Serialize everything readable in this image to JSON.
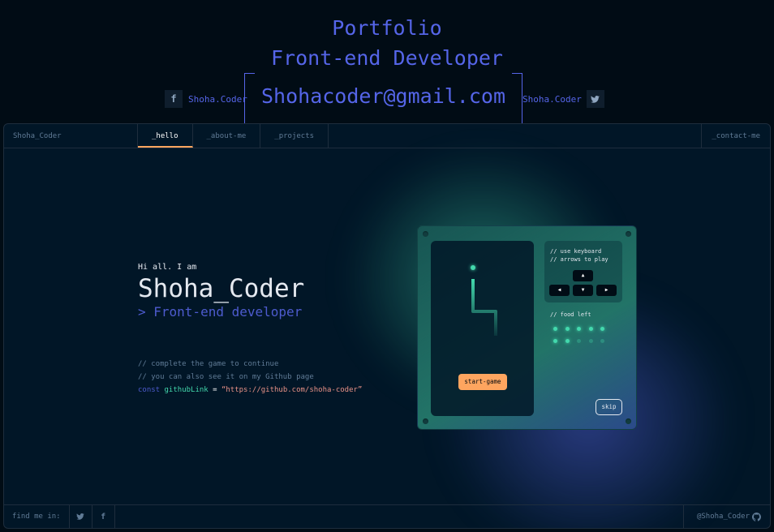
{
  "header": {
    "line1": "Portfolio",
    "line2": "Front-end Developer",
    "email": "Shohacoder@gmail.com",
    "facebook_label": "Shoha.Coder",
    "twitter_label": "Shoha.Coder",
    "facebook_icon": "f"
  },
  "nav": {
    "brand": "Shoha_Coder",
    "tabs": [
      "_hello",
      "_about-me",
      "_projects"
    ],
    "active_tab": "_hello",
    "contact": "_contact-me"
  },
  "intro": {
    "greeting": "Hi all. I am",
    "name": "Shoha_Coder",
    "role": "> Front-end developer",
    "comment1": "// complete the game to continue",
    "comment2": "// you can also see it on my Github page",
    "code_keyword": "const",
    "code_var": "githubLink",
    "code_eq": "=",
    "code_value": "“https://github.com/shoha-coder”"
  },
  "game": {
    "instructions": "// use keyboard\n// arrows to play",
    "food_label": "// food left",
    "food_total": 10,
    "food_remaining": 7,
    "start_label": "start-game",
    "skip_label": "skip",
    "key_up": "▲",
    "key_left": "◀",
    "key_down": "▼",
    "key_right": "▶"
  },
  "footer": {
    "find_me": "find me in:",
    "github_handle": "@Shoha_Coder"
  },
  "colors": {
    "accent_orange": "#fea55f",
    "accent_green": "#43d9ad",
    "accent_blue": "#4d5bce",
    "header_blue": "#5565e8"
  }
}
